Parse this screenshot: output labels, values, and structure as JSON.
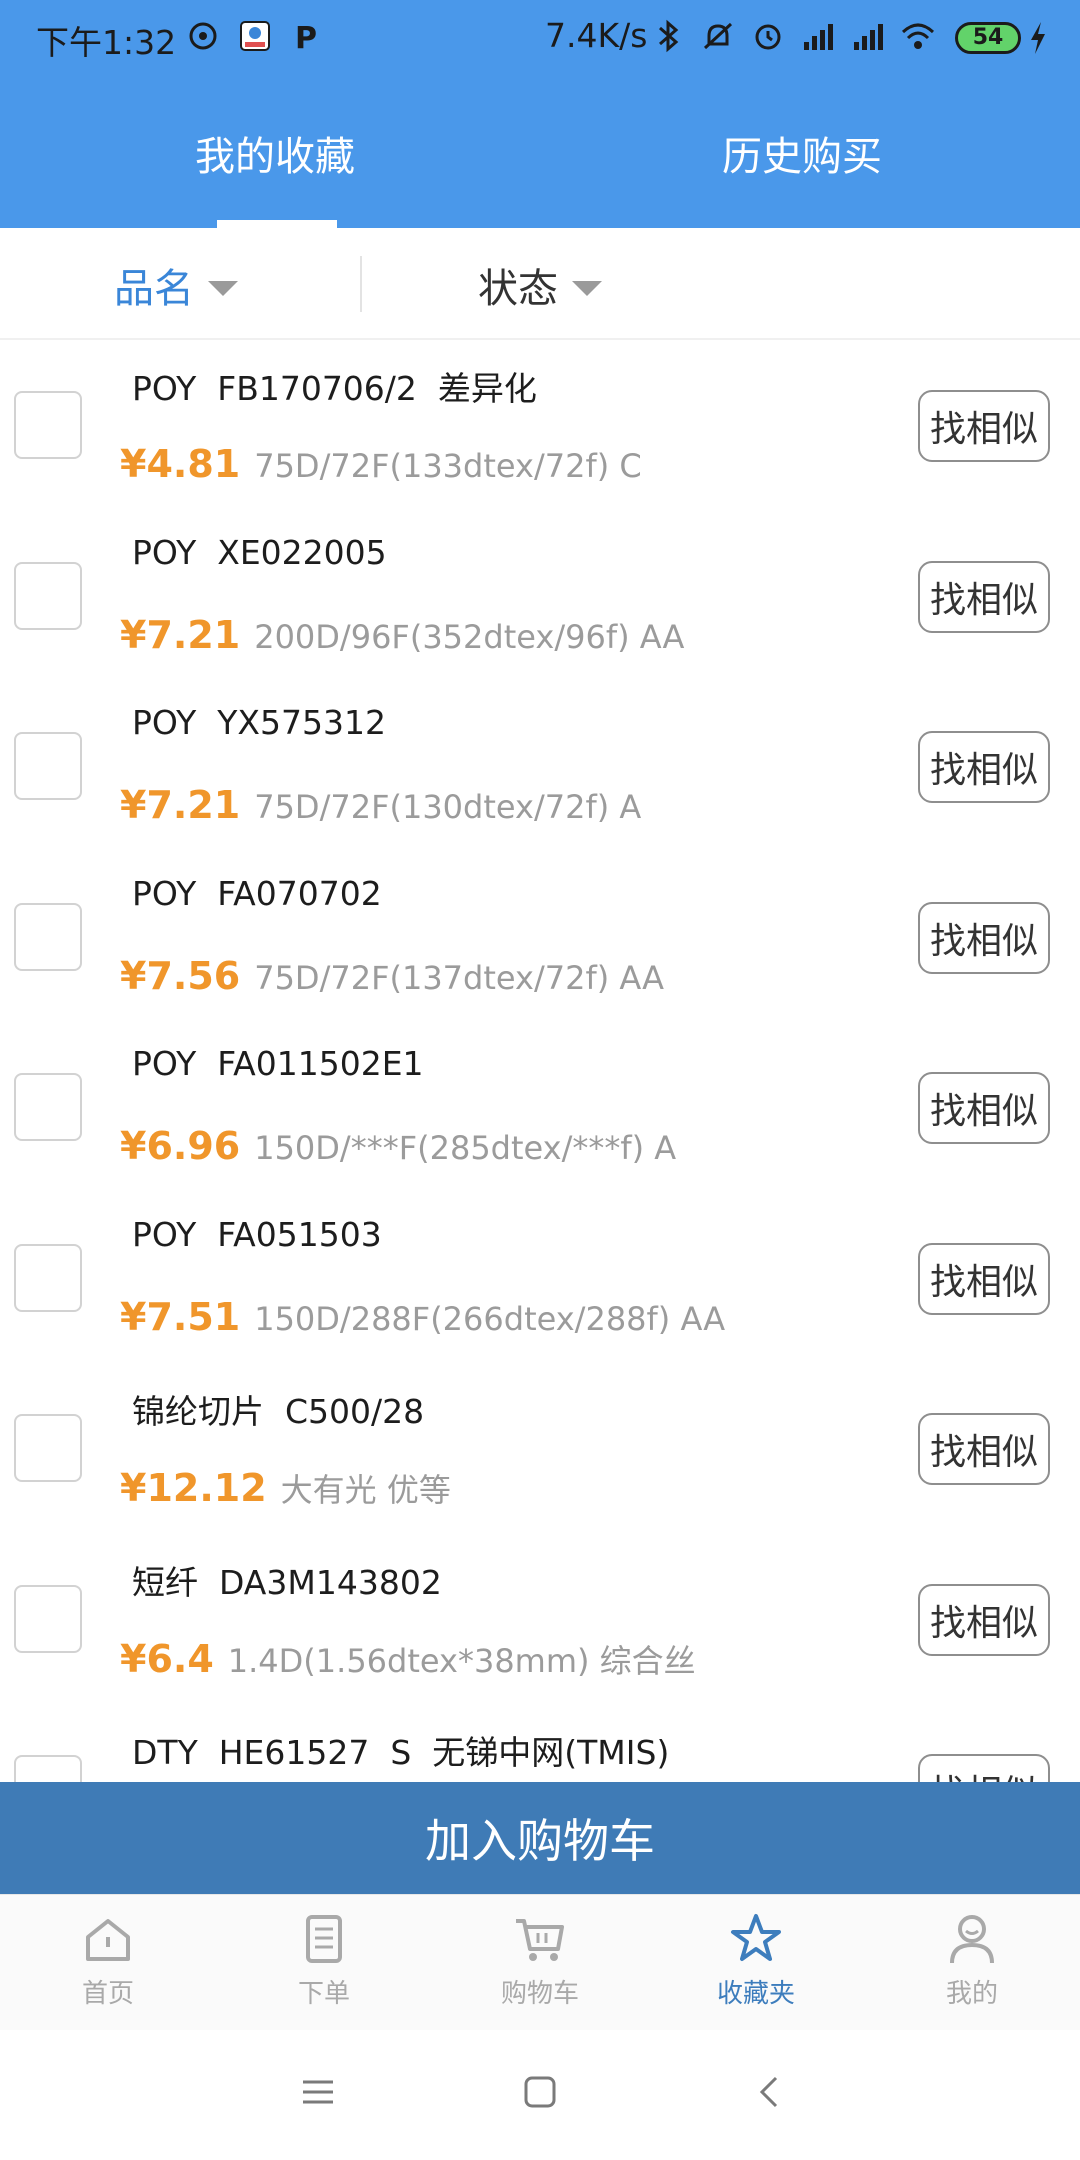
{
  "status": {
    "time": "下午1:32",
    "net_speed": "7.4K/s",
    "battery": "54"
  },
  "tabs": {
    "favorites": "我的收藏",
    "history": "历史购买"
  },
  "filters": {
    "name": "品名",
    "status": "状态"
  },
  "items": [
    {
      "title": "POY  FB170706/2  差异化",
      "price": "¥4.81",
      "spec": "75D/72F(133dtex/72f) C",
      "button": "找相似"
    },
    {
      "title": "POY  XE022005",
      "price": "¥7.21",
      "spec": "200D/96F(352dtex/96f) AA",
      "button": "找相似"
    },
    {
      "title": "POY  YX575312",
      "price": "¥7.21",
      "spec": "75D/72F(130dtex/72f) A",
      "button": "找相似"
    },
    {
      "title": "POY  FA070702",
      "price": "¥7.56",
      "spec": "75D/72F(137dtex/72f) AA",
      "button": "找相似"
    },
    {
      "title": "POY  FA011502E1",
      "price": "¥6.96",
      "spec": "150D/***F(285dtex/***f) A",
      "button": "找相似"
    },
    {
      "title": "POY  FA051503",
      "price": "¥7.51",
      "spec": "150D/288F(266dtex/288f) AA",
      "button": "找相似"
    },
    {
      "title": "锦纶切片  C500/28",
      "price": "¥12.12",
      "spec": "大有光 优等",
      "button": "找相似"
    },
    {
      "title": "短纤  DA3M143802",
      "price": "¥6.4",
      "spec": "1.4D(1.56dtex*38mm) 综合丝",
      "button": "找相似"
    },
    {
      "title": "DTY  HE61527  S  无锑中网(TMIS)",
      "price": "",
      "spec": "",
      "button": "找相似"
    }
  ],
  "add_to_cart": "加入购物车",
  "nav": {
    "home": "首页",
    "order": "下单",
    "cart": "购物车",
    "favorites": "收藏夹",
    "mine": "我的"
  },
  "colors": {
    "header": "#4a98ea",
    "accent_price": "#f0962b",
    "add_cart_bg": "#3f7bb6",
    "nav_active": "#3d7dbd"
  }
}
